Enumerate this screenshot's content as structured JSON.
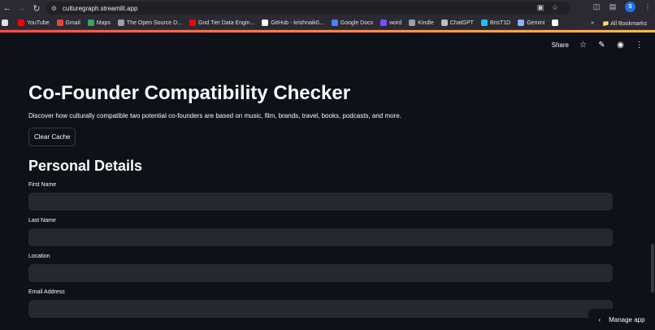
{
  "browser": {
    "url": "culturegraph.streamlit.app",
    "profile_initial": "S",
    "bookmarks": [
      {
        "label": "",
        "icon": "gmail-logo-icon",
        "color": "#e0e0e0"
      },
      {
        "label": "YouTube",
        "icon": "youtube-icon",
        "color": "#ff0000"
      },
      {
        "label": "Gmail",
        "icon": "gmail-icon",
        "color": "#ea4335"
      },
      {
        "label": "Maps",
        "icon": "maps-icon",
        "color": "#34a853"
      },
      {
        "label": "The Open Source D...",
        "icon": "open-source-icon",
        "color": "#9aa0a6"
      },
      {
        "label": "God Tier Data Engin...",
        "icon": "youtube-icon",
        "color": "#ff0000"
      },
      {
        "label": "GitHub - krishnaik0...",
        "icon": "github-icon",
        "color": "#ffffff"
      },
      {
        "label": "Google Docs",
        "icon": "docs-icon",
        "color": "#4285f4"
      },
      {
        "label": "word",
        "icon": "word-icon",
        "color": "#7c4dff"
      },
      {
        "label": "Kindle",
        "icon": "kindle-icon",
        "color": "#9aa0a6"
      },
      {
        "label": "ChatGPT",
        "icon": "chatgpt-icon",
        "color": "#bdbdbd"
      },
      {
        "label": "BrisT1D",
        "icon": "brist1d-icon",
        "color": "#20beff"
      },
      {
        "label": "Gemini",
        "icon": "gemini-icon",
        "color": "#8ab4f8"
      },
      {
        "label": "",
        "icon": "github-icon",
        "color": "#ffffff"
      }
    ],
    "all_bookmarks_label": "All Bookmarks"
  },
  "app_header": {
    "share_label": "Share"
  },
  "main": {
    "title": "Co-Founder Compatibility Checker",
    "description": "Discover how culturally compatible two potential co-founders are based on music, film, brands, travel, books, podcasts, and more.",
    "clear_cache_label": "Clear Cache",
    "section_title": "Personal Details",
    "fields": [
      {
        "label": "First Name"
      },
      {
        "label": "Last Name"
      },
      {
        "label": "Location"
      },
      {
        "label": "Email Address"
      }
    ]
  },
  "footer": {
    "manage_app_label": "Manage app"
  },
  "colors": {
    "background": "#0e1117",
    "input_background": "#262730",
    "text": "#fafafa",
    "chrome": "#2b2a33"
  }
}
